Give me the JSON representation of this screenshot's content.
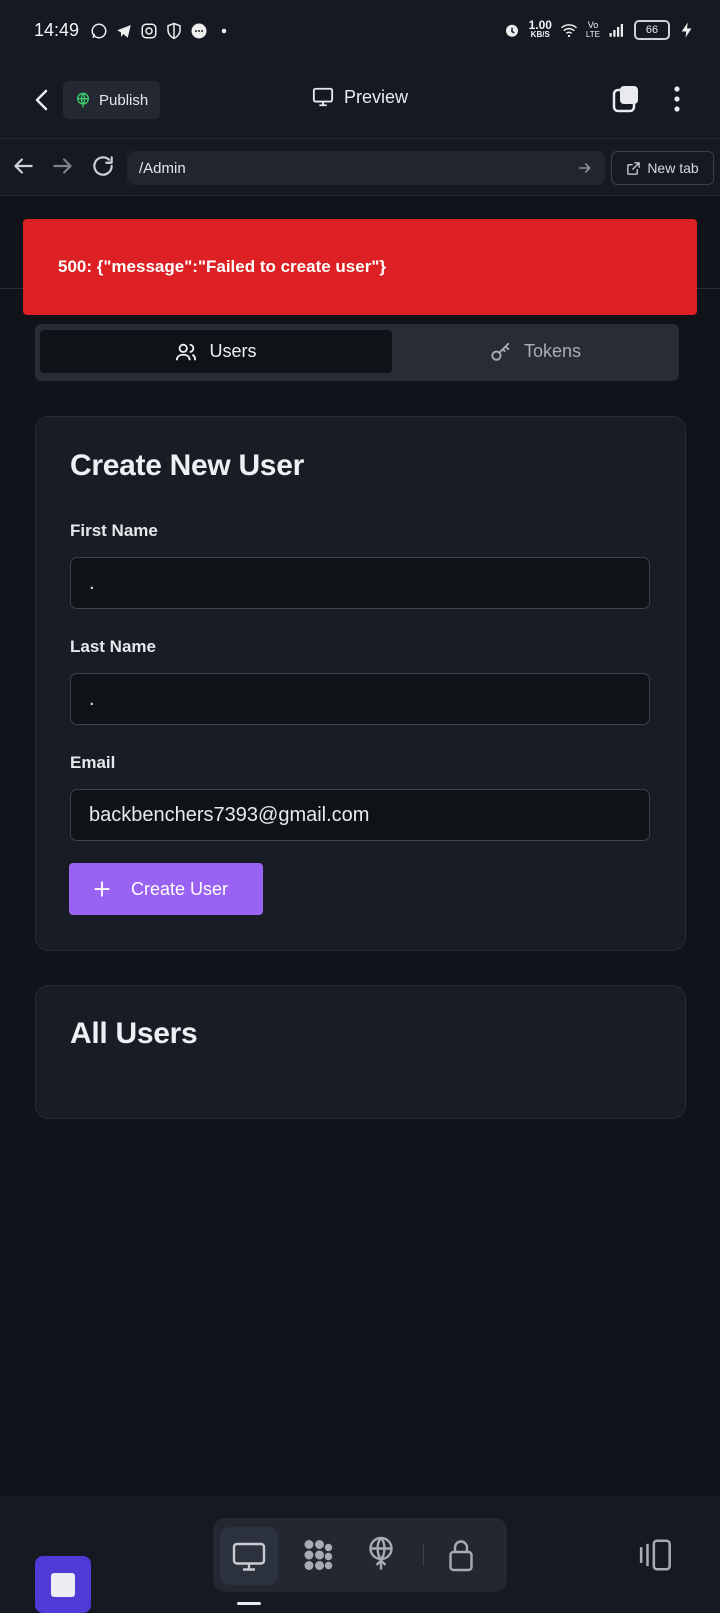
{
  "status_bar": {
    "time": "14:49",
    "net_speed_value": "1.00",
    "net_speed_unit": "KB/S",
    "volte_top": "Vo",
    "volte_bottom": "LTE",
    "battery": "66"
  },
  "app_bar": {
    "publish_label": "Publish",
    "preview_label": "Preview"
  },
  "url_bar": {
    "url": "/Admin",
    "new_tab_label": "New tab"
  },
  "error": {
    "text": "500: {\"message\":\"Failed to create user\"}"
  },
  "tabs": {
    "users_label": "Users",
    "tokens_label": "Tokens",
    "active": "Users"
  },
  "create_user": {
    "title": "Create New User",
    "first_name_label": "First Name",
    "first_name_value": ".",
    "last_name_label": "Last Name",
    "last_name_value": ".",
    "email_label": "Email",
    "email_value": "backbenchers7393@gmail.com",
    "button_label": "Create User"
  },
  "all_users": {
    "title": "All Users"
  },
  "colors": {
    "error": "#dc2023",
    "accent": "#9a62f2",
    "stop_button": "#4f3ad6"
  }
}
